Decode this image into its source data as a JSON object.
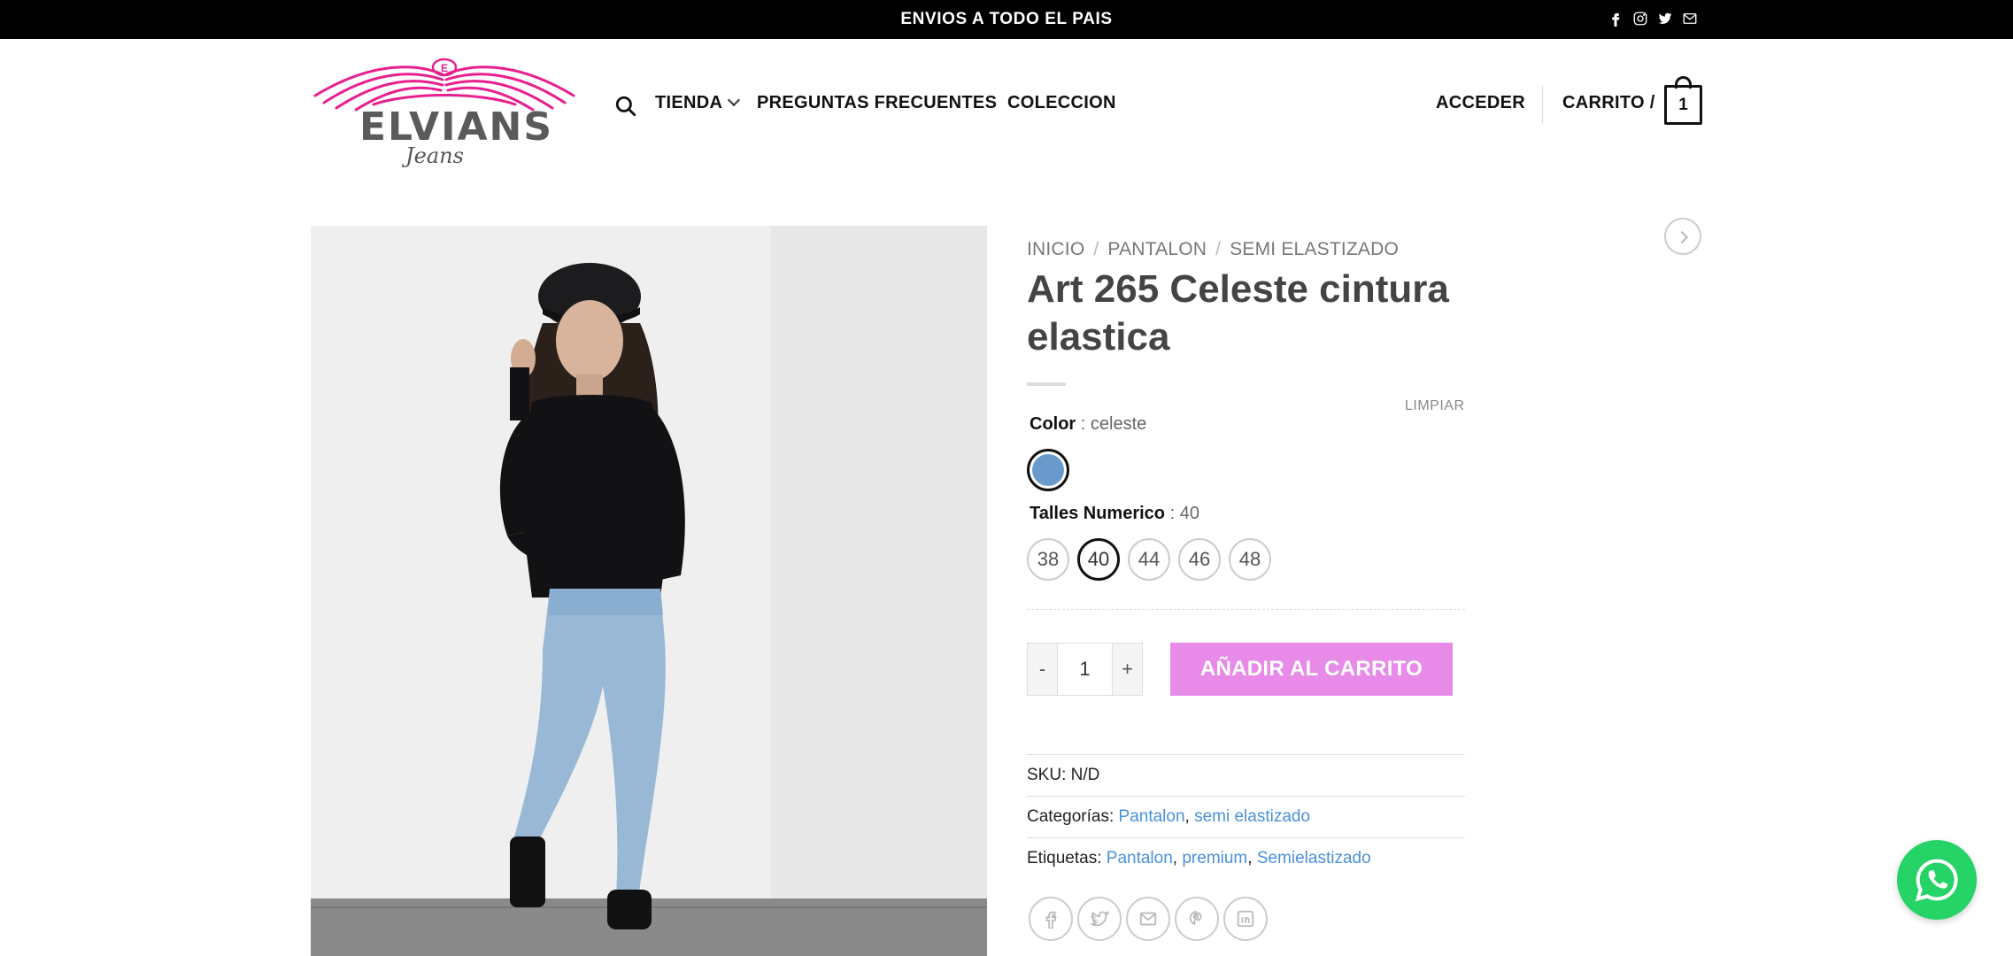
{
  "topbar": {
    "announcement": "ENVIOS A TODO EL PAIS",
    "social_icons": [
      "facebook-icon",
      "instagram-icon",
      "twitter-icon",
      "envelope-icon"
    ]
  },
  "header": {
    "logo": {
      "brand": "ELVIANS",
      "sub": "Jeans"
    },
    "nav": {
      "shop": "TIENDA",
      "faq": "PREGUNTAS FRECUENTES",
      "collection": "COLECCION"
    },
    "login": "ACCEDER",
    "cart_label": "CARRITO /",
    "cart_count": "1"
  },
  "product": {
    "breadcrumb": [
      "INICIO",
      "PANTALON",
      "SEMI ELASTIZADO"
    ],
    "title": "Art 265 Celeste cintura elastica",
    "clear_label": "LIMPIAR",
    "color": {
      "label": "Color",
      "value": ": celeste",
      "swatch": "#6a9acb"
    },
    "size": {
      "label": "Talles Numerico",
      "value": ": 40",
      "options": [
        "38",
        "40",
        "44",
        "46",
        "48"
      ],
      "selected": "40"
    },
    "quantity": {
      "minus": "-",
      "value": "1",
      "plus": "+"
    },
    "add_to_cart": "AÑADIR AL CARRITO",
    "meta": {
      "sku_label": "SKU:",
      "sku_value": "N/D",
      "categories_label": "Categorías:",
      "categories": [
        "Pantalon",
        "semi elastizado"
      ],
      "tags_label": "Etiquetas:",
      "tags": [
        "Pantalon",
        "premium",
        "Semielastizado"
      ],
      "separator": ","
    },
    "share_icons": [
      "facebook-icon",
      "twitter-icon",
      "envelope-icon",
      "pinterest-icon",
      "linkedin-icon"
    ]
  },
  "colors": {
    "accent": "#e88ae8",
    "link": "#4a90d9",
    "brand_pink": "#e8208f",
    "whatsapp": "#25d366"
  }
}
